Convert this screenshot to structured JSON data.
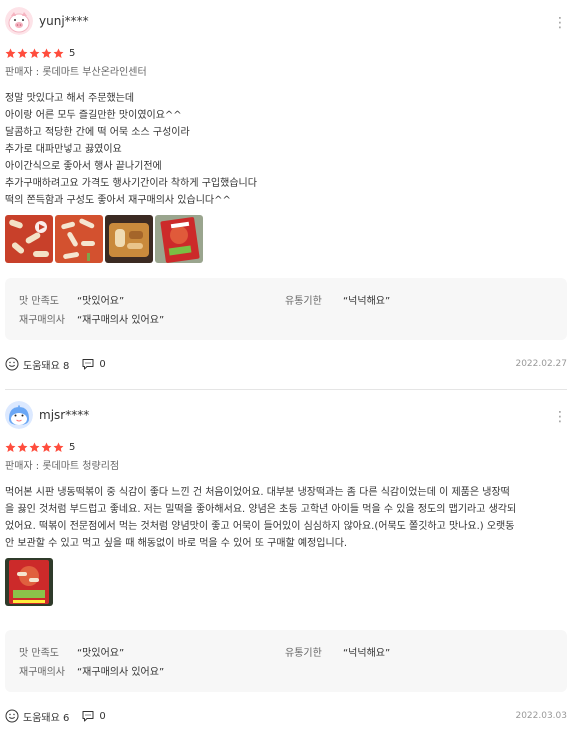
{
  "reviews": [
    {
      "username": "yunj****",
      "score": "5",
      "seller": "판매자 : 롯데마트 부산온라인센터",
      "body": "정말 맛있다고 해서 주문했는데\n아이랑 어른 모두 즐길만한 맛이였이요^^\n달콤하고 적당한 간에 떡 어묵 소스 구성이라\n추가로 대파만넣고 끓였이요\n아이간식으로 좋아서 행사 끝나기전에\n추가구매하려고요 가격도 행사기간이라 착하게 구입했습니다\n떡의 쫀득함과 구성도 좋아서 재구매의사 있습니다^^",
      "attrs": {
        "taste_label": "맛 만족도",
        "taste_value": "“맛있어요”",
        "expiry_label": "유통기한",
        "expiry_value": "“넉넉해요”",
        "repurchase_label": "재구매의사",
        "repurchase_value": "“재구매의사 있어요”"
      },
      "helpful": "도움돼요 8",
      "comments": "0",
      "date": "2022.02.27"
    },
    {
      "username": "mjsr****",
      "score": "5",
      "seller": "판매자 : 롯데마트 청량리점",
      "body": "먹어본 시판 냉동떡볶이 중 식감이 좋다 느낀 건 처음이었어요. 대부분 냉장떡과는 좀 다른 식감이었는데 이 제품은 냉장떡\n을 끓인 것처럼 부드럽고 좋네요. 저는 밀떡을 좋아해서요. 양념은 초등 고학년 아이들 먹을 수 있을 정도의 맵기라고 생각되\n었어요. 떡볶이 전문점에서 먹는 것처럼 양념맛이 좋고 어묵이 들어있이 심심하지 않아요.(어묵도 쫄깃하고 맛나요.) 오랫동\n안 보관할 수 있고 먹고 싶을 때 해동없이 바로 먹을 수 있어 또 구매할 예정입니다.",
      "attrs": {
        "taste_label": "맛 만족도",
        "taste_value": "“맛있어요”",
        "expiry_label": "유통기한",
        "expiry_value": "“넉넉해요”",
        "repurchase_label": "재구매의사",
        "repurchase_value": "“재구매의사 있어요”"
      },
      "helpful": "도움돼요 6",
      "comments": "0",
      "date": "2022.03.03"
    }
  ],
  "colors": {
    "star": "#ff4d3d",
    "attr_bg": "#f7f7f7"
  }
}
